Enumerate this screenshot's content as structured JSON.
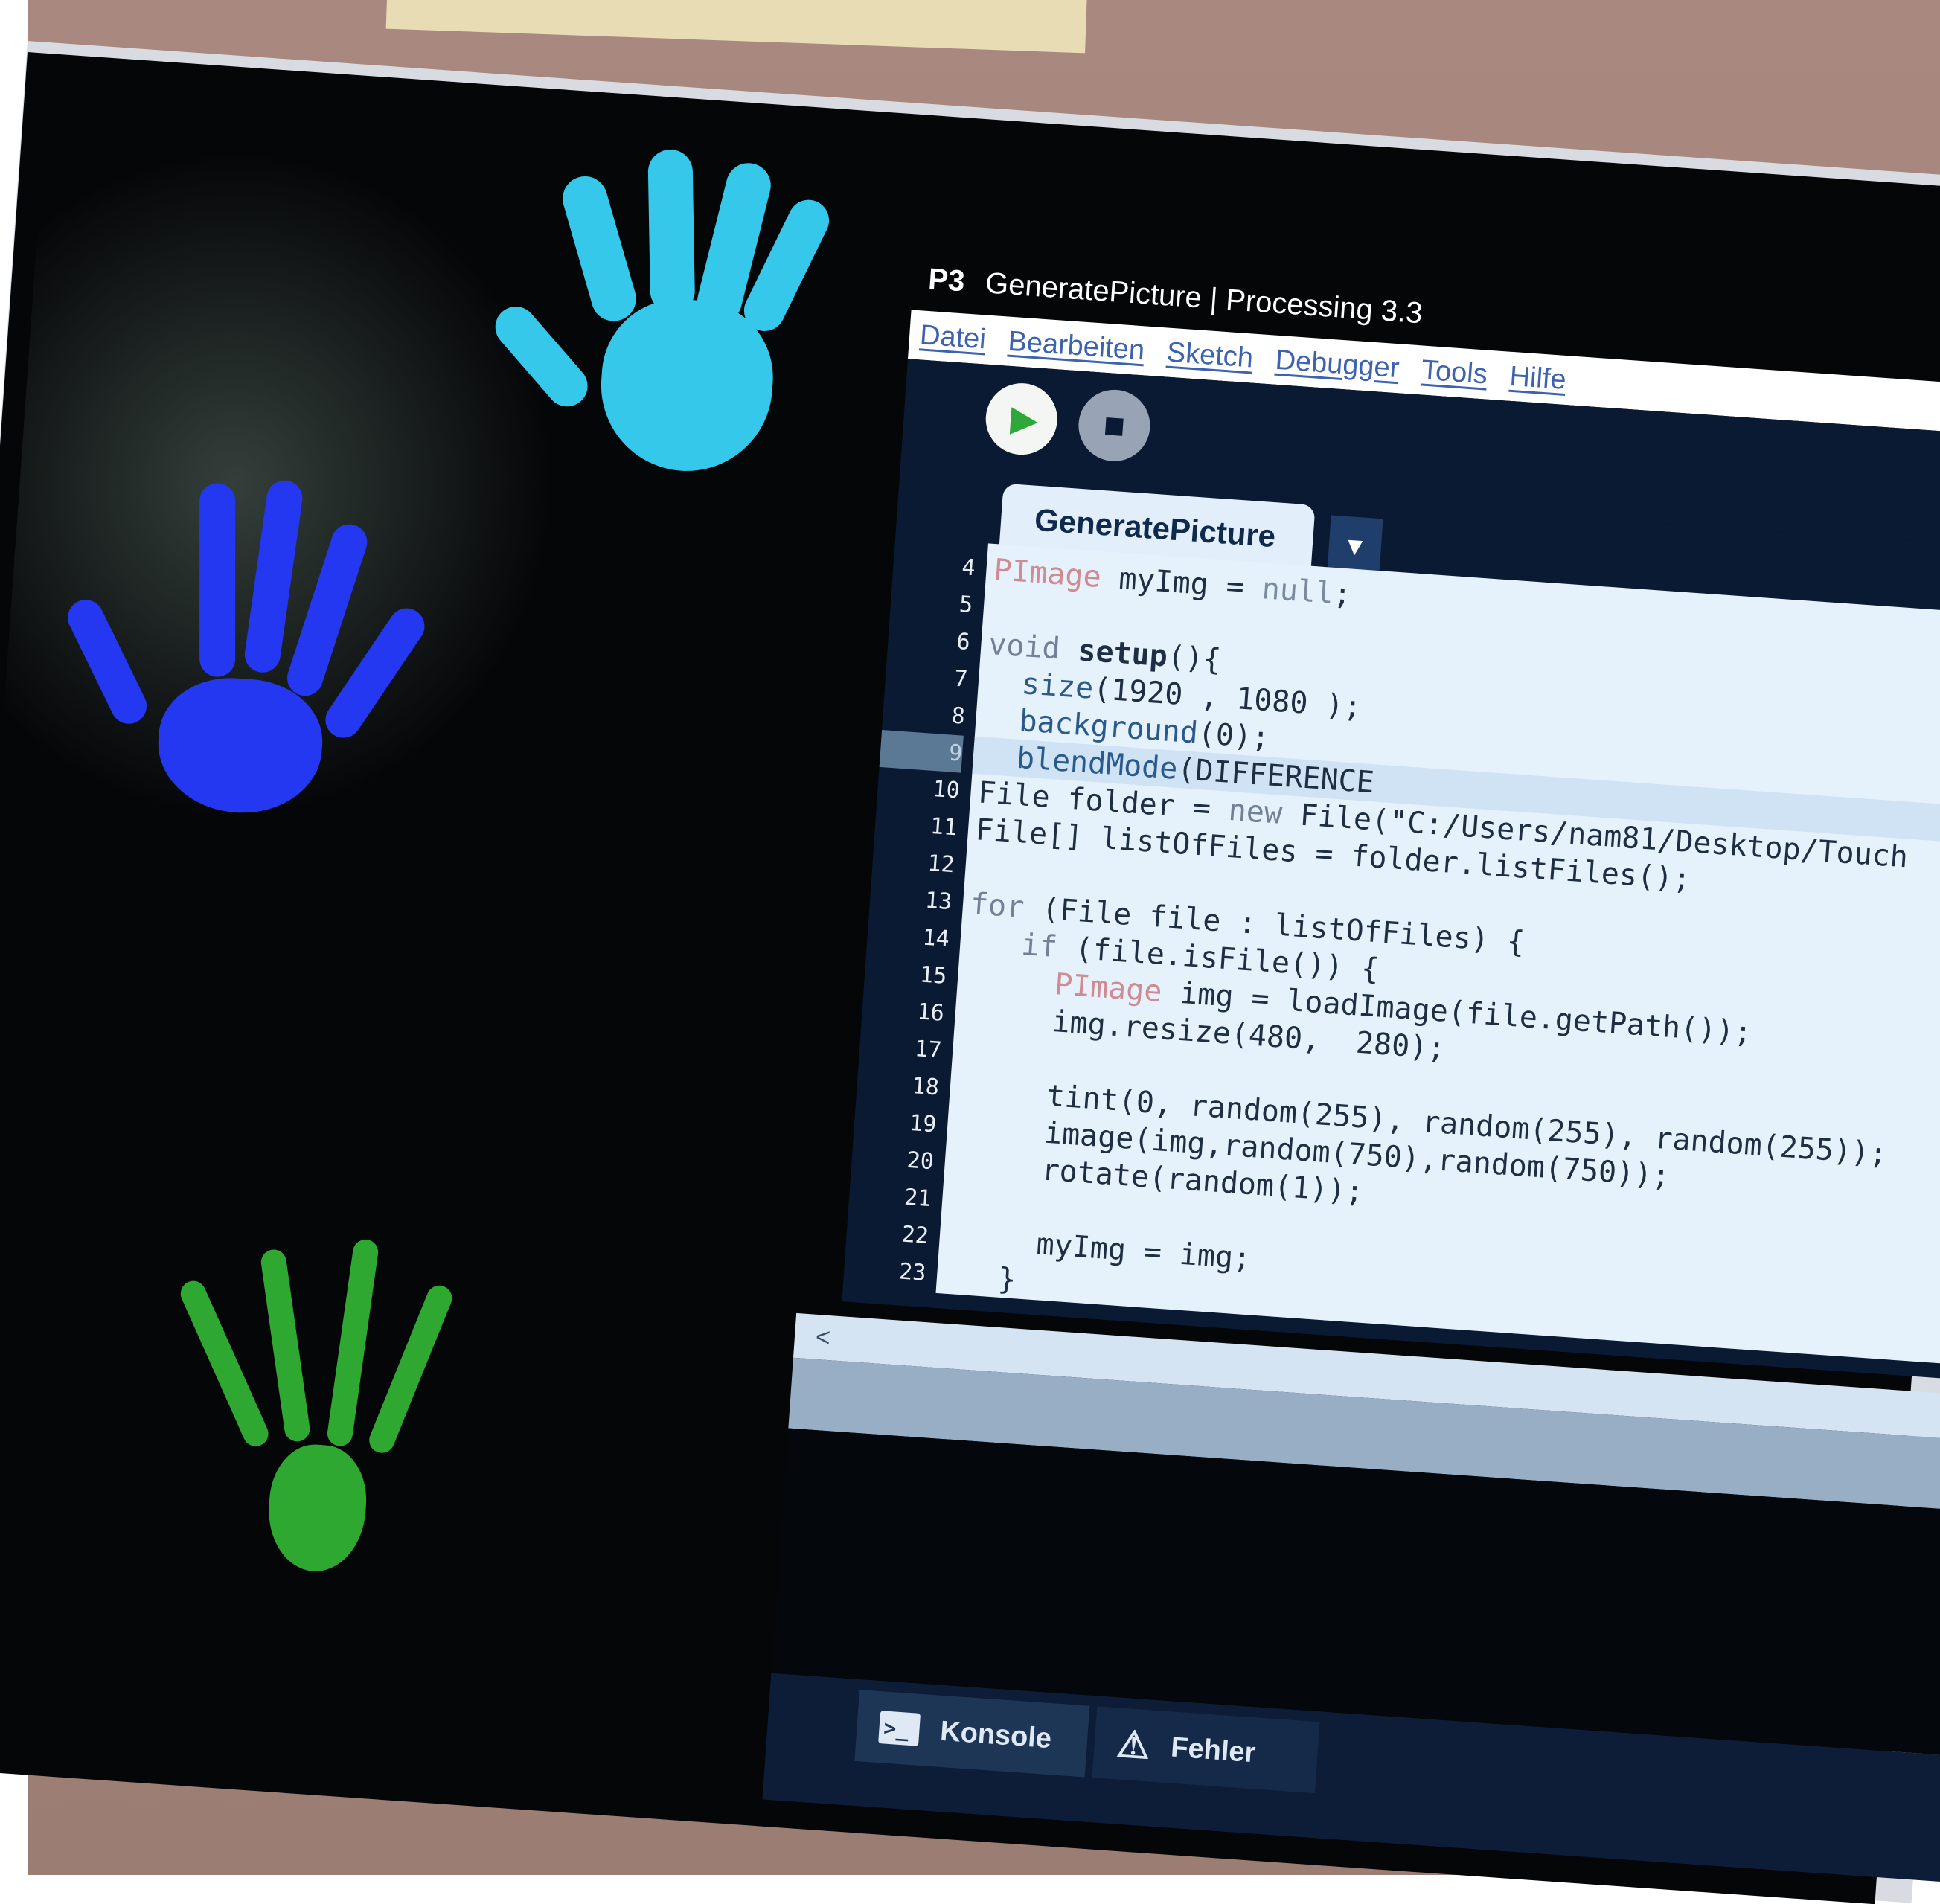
{
  "window": {
    "app_logo": "P3",
    "title": "GeneratePicture | Processing 3.3"
  },
  "menu": [
    "Datei",
    "Bearbeiten",
    "Sketch",
    "Debugger",
    "Tools",
    "Hilfe"
  ],
  "toolbar": {
    "run_icon": "▶",
    "stop_icon": "■"
  },
  "tabs": {
    "sketch_tab": "GeneratePicture",
    "tab_menu_icon": "▼"
  },
  "editor": {
    "current_line": 9,
    "line_numbers": [
      "4",
      "5",
      "6",
      "7",
      "8",
      "9",
      "10",
      "11",
      "12",
      "13",
      "14",
      "15",
      "16",
      "17",
      "18",
      "19",
      "20",
      "21",
      "22",
      "23"
    ],
    "lines": [
      "PImage myImg = null;",
      "",
      "void setup(){",
      "  size(1920 , 1080 );",
      "  background(0);",
      "  blendMode(DIFFERENCE",
      "File folder = new File(\"C:/Users/nam81/Desktop/Touch",
      "File[] listOfFiles = folder.listFiles();",
      "",
      "for (File file : listOfFiles) {",
      "   if (file.isFile()) {",
      "     PImage img = loadImage(file.getPath());",
      "     img.resize(480,  280);",
      "",
      "     tint(0, random(255), random(255), random(255));",
      "     image(img,random(750),random(750));",
      "     rotate(random(1));",
      "",
      "     myImg = img;",
      "   }"
    ],
    "trailing_text": ");",
    "scroll_left_icon": "<"
  },
  "bottom_tabs": {
    "console_label": "Konsole",
    "console_icon": ">_",
    "errors_label": "Fehler",
    "warning_icon": "⚠"
  },
  "colors": {
    "accent_blue": "#3d63b0",
    "editor_bg": "#e5f1fb",
    "ide_dark": "#0b1a33",
    "hand_cyan": "#36c8ea",
    "hand_blue": "#2438f2",
    "hand_green": "#2fa832"
  }
}
